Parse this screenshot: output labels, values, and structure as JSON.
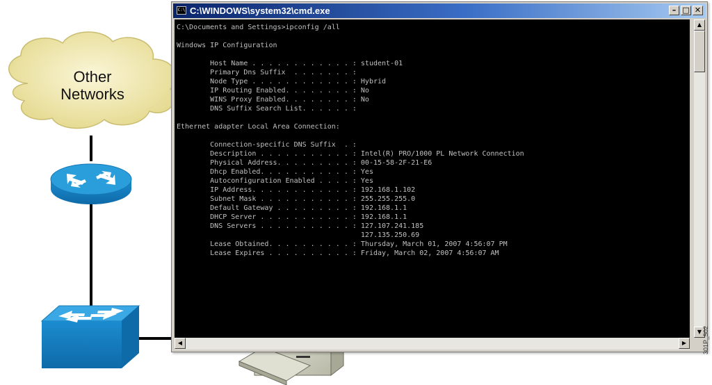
{
  "cloud": {
    "line1": "Other",
    "line2": "Networks"
  },
  "window": {
    "title": "C:\\WINDOWS\\system32\\cmd.exe",
    "icon_text": "C:\\",
    "buttons": {
      "minimize": "–",
      "maximize": "□",
      "close": "✕"
    }
  },
  "console": {
    "lines": [
      "C:\\Documents and Settings>ipconfig /all",
      "",
      "Windows IP Configuration",
      "",
      "        Host Name . . . . . . . . . . . . : student-01",
      "        Primary Dns Suffix  . . . . . . . :",
      "        Node Type . . . . . . . . . . . . : Hybrid",
      "        IP Routing Enabled. . . . . . . . : No",
      "        WINS Proxy Enabled. . . . . . . . : No",
      "        DNS Suffix Search List. . . . . . :",
      "",
      "Ethernet adapter Local Area Connection:",
      "",
      "        Connection-specific DNS Suffix  . :",
      "        Description . . . . . . . . . . . : Intel(R) PRO/1000 PL Network Connection",
      "        Physical Address. . . . . . . . . : 00-15-58-2F-21-E6",
      "        Dhcp Enabled. . . . . . . . . . . : Yes",
      "        Autoconfiguration Enabled . . . . : Yes",
      "        IP Address. . . . . . . . . . . . : 192.168.1.102",
      "        Subnet Mask . . . . . . . . . . . : 255.255.255.0",
      "        Default Gateway . . . . . . . . . : 192.168.1.1",
      "        DHCP Server . . . . . . . . . . . : 192.168.1.1",
      "        DNS Servers . . . . . . . . . . . : 127.107.241.185",
      "                                            127.135.250.69",
      "        Lease Obtained. . . . . . . . . . : Thursday, March 01, 2007 4:56:07 PM",
      "        Lease Expires . . . . . . . . . . : Friday, March 02, 2007 4:56:07 AM"
    ]
  },
  "scrollbars": {
    "up": "▲",
    "down": "▼",
    "left": "◀",
    "right": "▶"
  },
  "figure_id": "301P_502",
  "colors": {
    "console_bg": "#000000",
    "console_text": "#c0c0c0",
    "title_gradient_start": "#0a246a",
    "title_gradient_end": "#a6caf0",
    "device_blue": "#1e8fcf",
    "cloud_fill": "#f2eab0"
  }
}
